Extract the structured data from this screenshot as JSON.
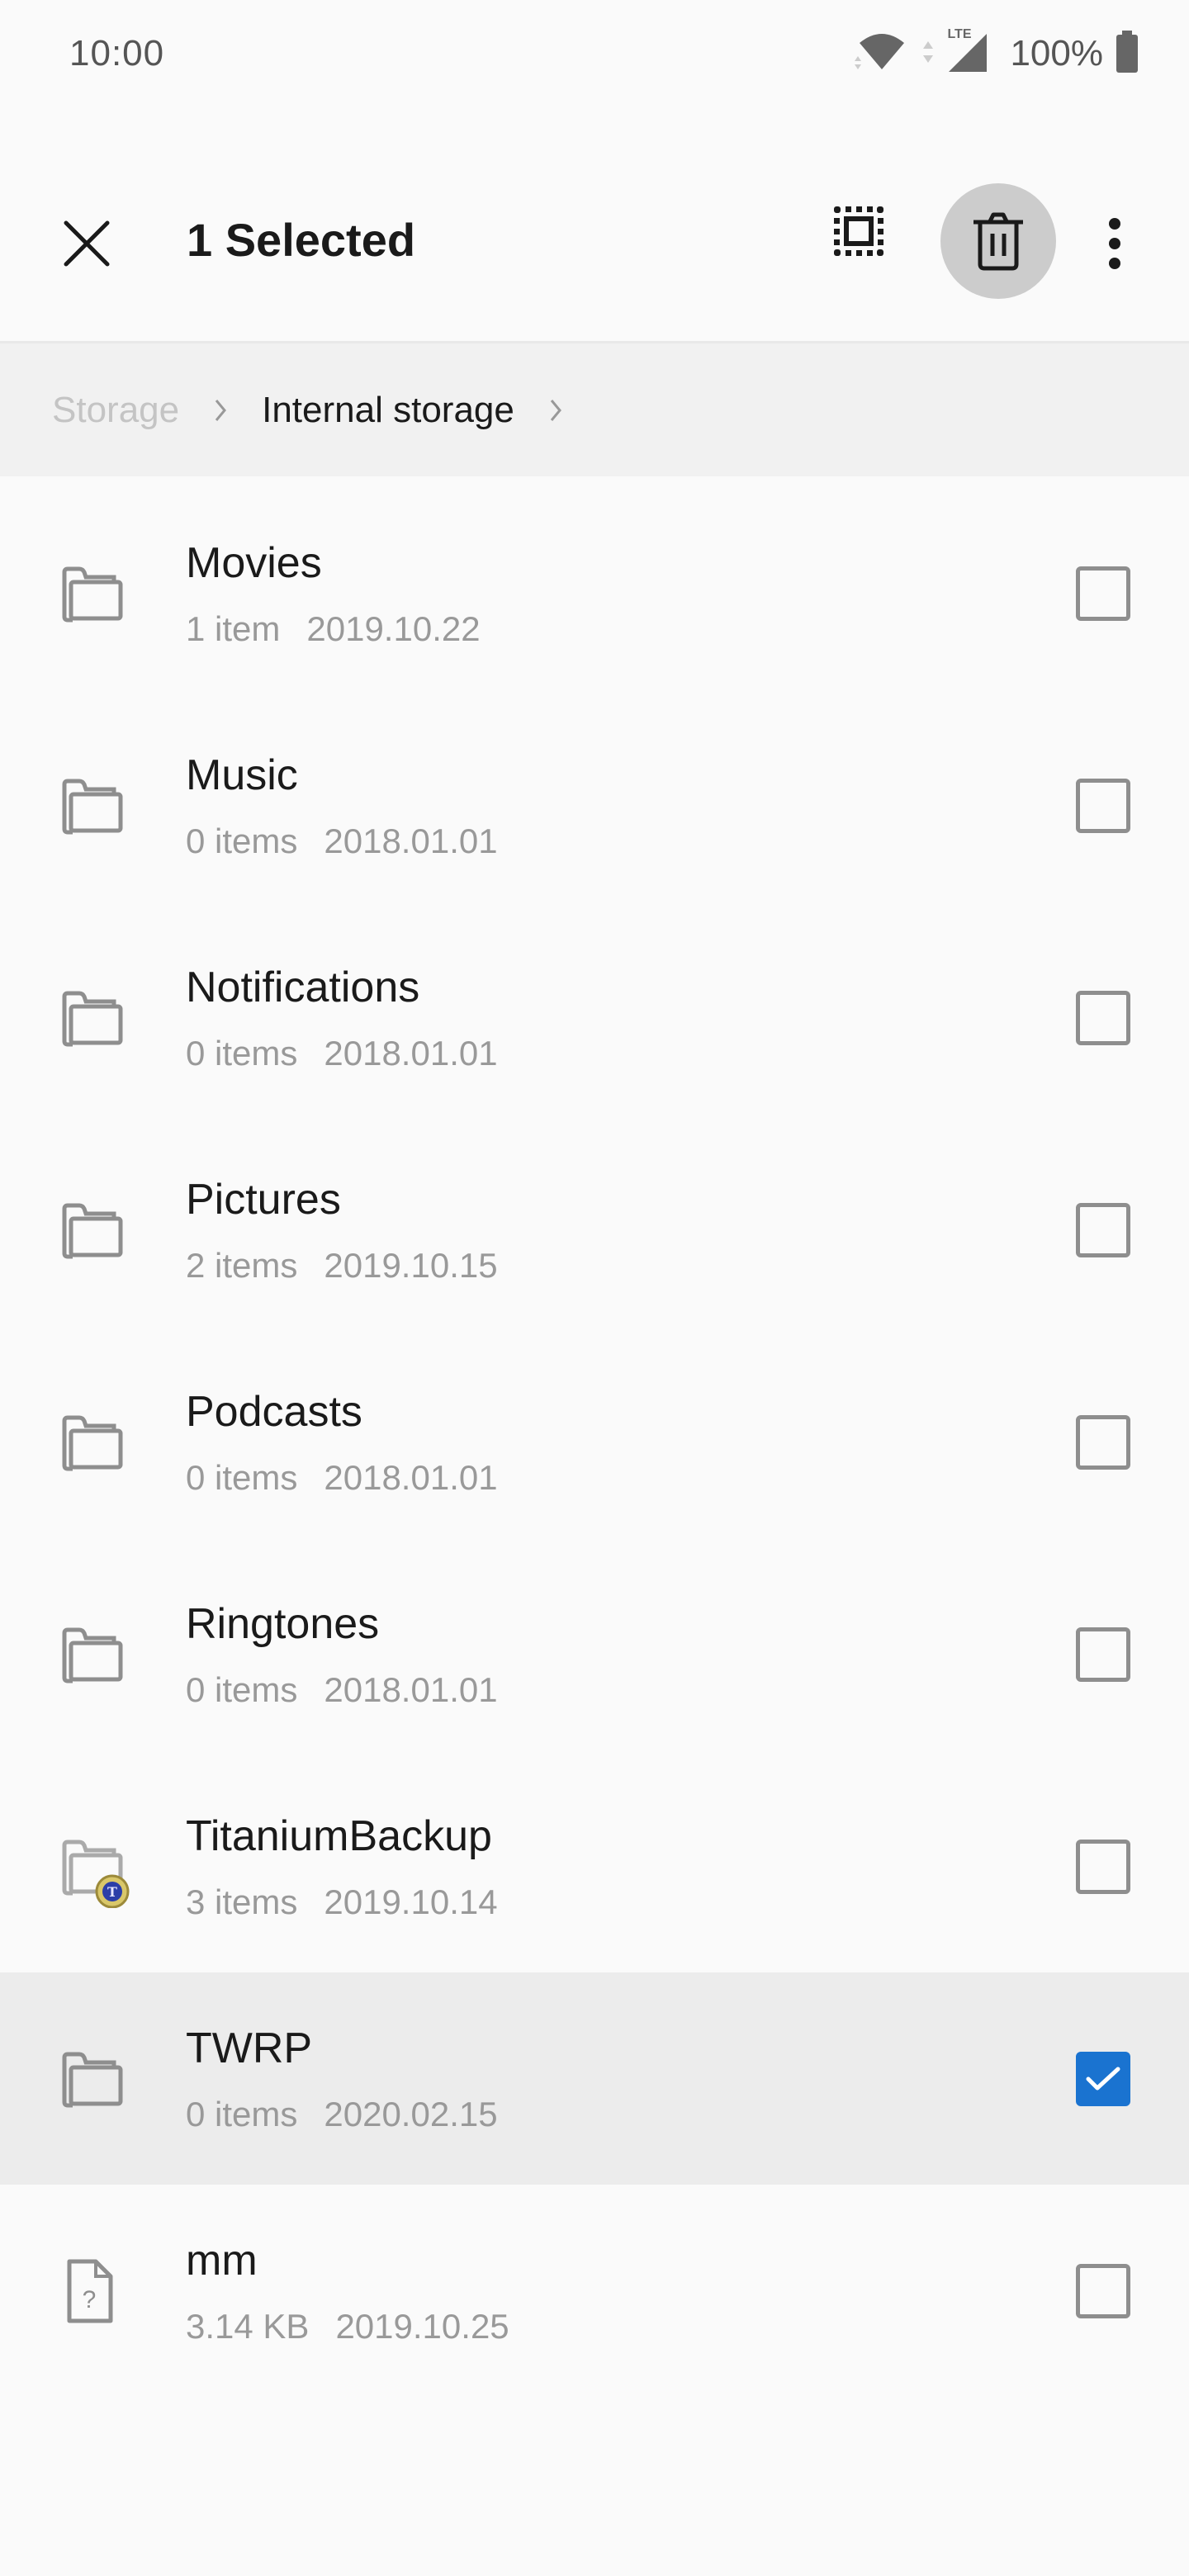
{
  "status_bar": {
    "time": "10:00",
    "network_label": "LTE",
    "battery_percent": "100%",
    "icons": [
      "wifi-icon",
      "mobile-data-icon",
      "signal-icon",
      "battery-icon"
    ]
  },
  "action_bar": {
    "title": "1 Selected",
    "close_icon": "close-icon",
    "select_all_icon": "select-all-icon",
    "delete_icon": "trash-icon",
    "more_icon": "more-vert-icon"
  },
  "breadcrumb": {
    "items": [
      {
        "label": "Storage",
        "active": false
      },
      {
        "label": "Internal storage",
        "active": true
      }
    ]
  },
  "colors": {
    "accent": "#1a73d0",
    "selected_row_bg": "#ececec",
    "delete_button_bg": "#cccccc",
    "meta_text": "#999999",
    "icon_gray": "#8e8e8e"
  },
  "files": [
    {
      "name": "Movies",
      "count": "1 item",
      "date": "2019.10.22",
      "type": "folder",
      "selected": false
    },
    {
      "name": "Music",
      "count": "0 items",
      "date": "2018.01.01",
      "type": "folder",
      "selected": false
    },
    {
      "name": "Notifications",
      "count": "0 items",
      "date": "2018.01.01",
      "type": "folder",
      "selected": false
    },
    {
      "name": "Pictures",
      "count": "2 items",
      "date": "2019.10.15",
      "type": "folder",
      "selected": false
    },
    {
      "name": "Podcasts",
      "count": "0 items",
      "date": "2018.01.01",
      "type": "folder",
      "selected": false
    },
    {
      "name": "Ringtones",
      "count": "0 items",
      "date": "2018.01.01",
      "type": "folder",
      "selected": false
    },
    {
      "name": "TitaniumBackup",
      "count": "3 items",
      "date": "2019.10.14",
      "type": "app-folder",
      "selected": false
    },
    {
      "name": "TWRP",
      "count": "0 items",
      "date": "2020.02.15",
      "type": "folder",
      "selected": true
    },
    {
      "name": "mm",
      "count": "3.14 KB",
      "date": "2019.10.25",
      "type": "unknown-file",
      "selected": false
    }
  ]
}
